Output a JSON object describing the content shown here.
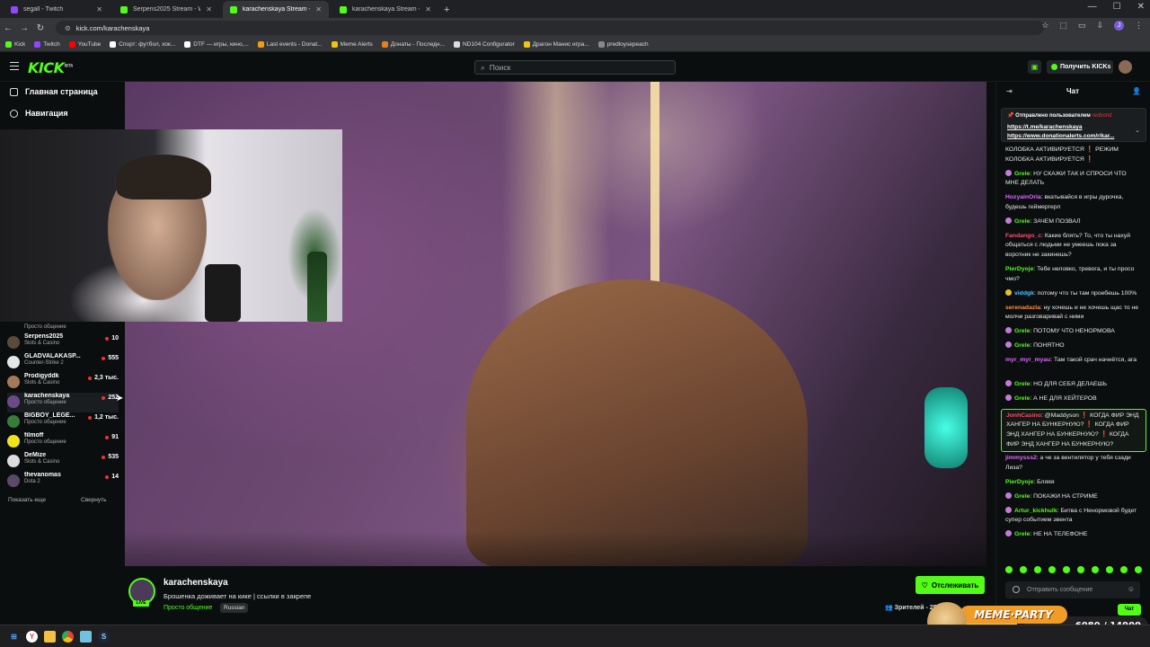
{
  "browser": {
    "tabs": [
      {
        "title": "segall - Twitch",
        "color": "#9146ff",
        "active": false
      },
      {
        "title": "Serpens2025 Stream - Watch Li",
        "color": "#53fc18",
        "active": false
      },
      {
        "title": "karachenskaya Stream - Watch",
        "color": "#53fc18",
        "active": true
      },
      {
        "title": "karachenskaya Stream - Watch",
        "color": "#53fc18",
        "active": false
      }
    ],
    "new_tab": "+",
    "url": "kick.com/karachenskaya",
    "bookmarks": [
      {
        "label": "Kick",
        "color": "#53fc18"
      },
      {
        "label": "Twitch",
        "color": "#9146ff"
      },
      {
        "label": "YouTube",
        "color": "#ff0000"
      },
      {
        "label": "Спорт: футбол, хок...",
        "color": "#ffffff"
      },
      {
        "label": "DTF — игры, кино,...",
        "color": "#ffffff"
      },
      {
        "label": "Last events - Donat...",
        "color": "#f39c12"
      },
      {
        "label": "Meme Alerts",
        "color": "#f1c40f"
      },
      {
        "label": "Донаты - Последн...",
        "color": "#e67e22"
      },
      {
        "label": "ND104 Configurator",
        "color": "#dddddd"
      },
      {
        "label": "Драгон Манис игра...",
        "color": "#f1c40f"
      },
      {
        "label": "predloysepeach",
        "color": "#888888"
      }
    ]
  },
  "header": {
    "logo": "KICK",
    "logo_tag": "BETA",
    "search_placeholder": "Поиск",
    "get_kicks": "Получить KICKs"
  },
  "sidebar": {
    "nav": [
      {
        "label": "Главная страница",
        "icon": "home-icon"
      },
      {
        "label": "Навигация",
        "icon": "compass-icon"
      }
    ],
    "partial_category": "Просто общение",
    "channels": [
      {
        "name": "Serpens2025",
        "category": "Slots & Casino",
        "viewers": "10",
        "color": "#5a4a3a"
      },
      {
        "name": "GLADVALAKASP...",
        "category": "Counter-Strike 2",
        "viewers": "555",
        "color": "#e6e6e6"
      },
      {
        "name": "Prodigyddk",
        "category": "Slots & Casino",
        "viewers": "2,3 тыс.",
        "color": "#a5785a"
      },
      {
        "name": "karachenskaya",
        "category": "Просто общение",
        "viewers": "252",
        "color": "#6b4a8a",
        "selected": true
      },
      {
        "name": "BIGBOY_LEGE...",
        "category": "Просто общение",
        "viewers": "1,2 тыс.",
        "color": "#3a7a3a"
      },
      {
        "name": "filmoff",
        "category": "Просто общение",
        "viewers": "91",
        "color": "#f1e21c"
      },
      {
        "name": "DeMize",
        "category": "Slots & Casino",
        "viewers": "535",
        "color": "#dddddd"
      },
      {
        "name": "thevanomas",
        "category": "Dota 2",
        "viewers": "14",
        "color": "#5a4a6a"
      }
    ],
    "show_more": "Показать еще",
    "collapse": "Свернуть"
  },
  "stream": {
    "channel": "karachenskaya",
    "live": "LIVE",
    "title": "Брошенка доживает на кике | ссылки в закрепе",
    "category": "Просто общение",
    "language": "Russian",
    "follow": "Отслеживать",
    "viewers_label": "Зрителей - 25"
  },
  "chat": {
    "title": "Чат",
    "pinned": {
      "by": "Отправлено пользователем",
      "by_user": "reobond",
      "link1": "https://t.me/karachenskaya",
      "link2": "https://www.donationalerts.com/r/kar..."
    },
    "messages": [
      {
        "user": "",
        "color": "#e8e8e8",
        "text": "КОЛОБКА АКТИВИРУЕТСЯ ❗ РЕЖИМ КОЛОБКА АКТИВИРУЕТСЯ ❗"
      },
      {
        "user": "Grele",
        "color": "#53fc18",
        "badge": "#c47bd6",
        "text": "НУ СКАЖИ ТАК И СПРОСИ ЧТО МНЕ ДЕЛАТЬ"
      },
      {
        "user": "HozyainOrla",
        "color": "#e066ff",
        "text": "вкатывайся в игры дурочка, будешь геймергерл"
      },
      {
        "user": "Grele",
        "color": "#53fc18",
        "badge": "#c47bd6",
        "text": "ЗАЧЕМ ПОЗВАЛ"
      },
      {
        "user": "Fandango_c",
        "color": "#ff4d6d",
        "text": "Какие блять? То, что ты нахуй общаться с людьми не умеешь пока за воротник не закинешь?"
      },
      {
        "user": "PierDyoje",
        "color": "#53fc18",
        "text": "Тебе неловко, тревога, и ты просо чмо?"
      },
      {
        "user": "viddgk",
        "color": "#4dc3ff",
        "badge": "#e6c229",
        "text": "потому что ты там проебешь 100%"
      },
      {
        "user": "serenadazla",
        "color": "#ff8c42",
        "text": "ну хочешь и не хочешь щас то не молчи разговаривай с ними"
      },
      {
        "user": "Grele",
        "color": "#53fc18",
        "badge": "#c47bd6",
        "text": "ПОТОМУ ЧТО НЕНОРМОВА"
      },
      {
        "user": "Grele",
        "color": "#53fc18",
        "badge": "#c47bd6",
        "text": "ПОНЯТНО"
      },
      {
        "user": "myr_myr_myau",
        "color": "#e066ff",
        "text": "Там такой срач начнётся, ага"
      },
      {
        "user": "Grele",
        "color": "#53fc18",
        "badge": "#c47bd6",
        "text": "НО ДЛЯ СЕБЯ ДЕЛАЕШЬ"
      },
      {
        "user": "Grele",
        "color": "#53fc18",
        "badge": "#c47bd6",
        "text": "А НЕ ДЛЯ ХЕЙТЕРОВ"
      },
      {
        "user": "JonhCasino",
        "color": "#ff4d6d",
        "text": "@Maddyson ❗ КОГДА ФИР ЭНД ХАНГЕР НА БУНКЕРНУЮ? ❗ КОГДА ФИР ЭНД ХАНГЕР НА БУНКЕРНУЮ? ❗ КОГДА ФИР ЭНД ХАНГЕР НА БУНКЕРНУЮ?",
        "highlight": true
      },
      {
        "user": "jimmysss2",
        "color": "#e066ff",
        "text": "а че за вентилятор у тебя сзади Лиза?"
      },
      {
        "user": "PierDyoje",
        "color": "#53fc18",
        "text": "Бляяя"
      },
      {
        "user": "Grele",
        "color": "#53fc18",
        "badge": "#c47bd6",
        "text": "ПОКАЖИ НА СТРИМЕ"
      },
      {
        "user": "Artur_kickhulk",
        "color": "#53fc18",
        "badge": "#c47bd6",
        "text": "Битва с Ненормовой будет супер событием эвента"
      },
      {
        "user": "Grele",
        "color": "#53fc18",
        "badge": "#c47bd6",
        "text": "НЕ НА ТЕЛЕФОНЕ"
      }
    ],
    "input_placeholder": "Отправить сообщение",
    "send": "Чат"
  },
  "overlay": {
    "meme_party": "MEME·PARTY",
    "count": "6080 / 14900"
  },
  "taskbar": {
    "icons": [
      "windows-icon",
      "yandex-icon",
      "folder-icon",
      "chrome-icon",
      "notepad-icon",
      "steam-icon"
    ]
  }
}
